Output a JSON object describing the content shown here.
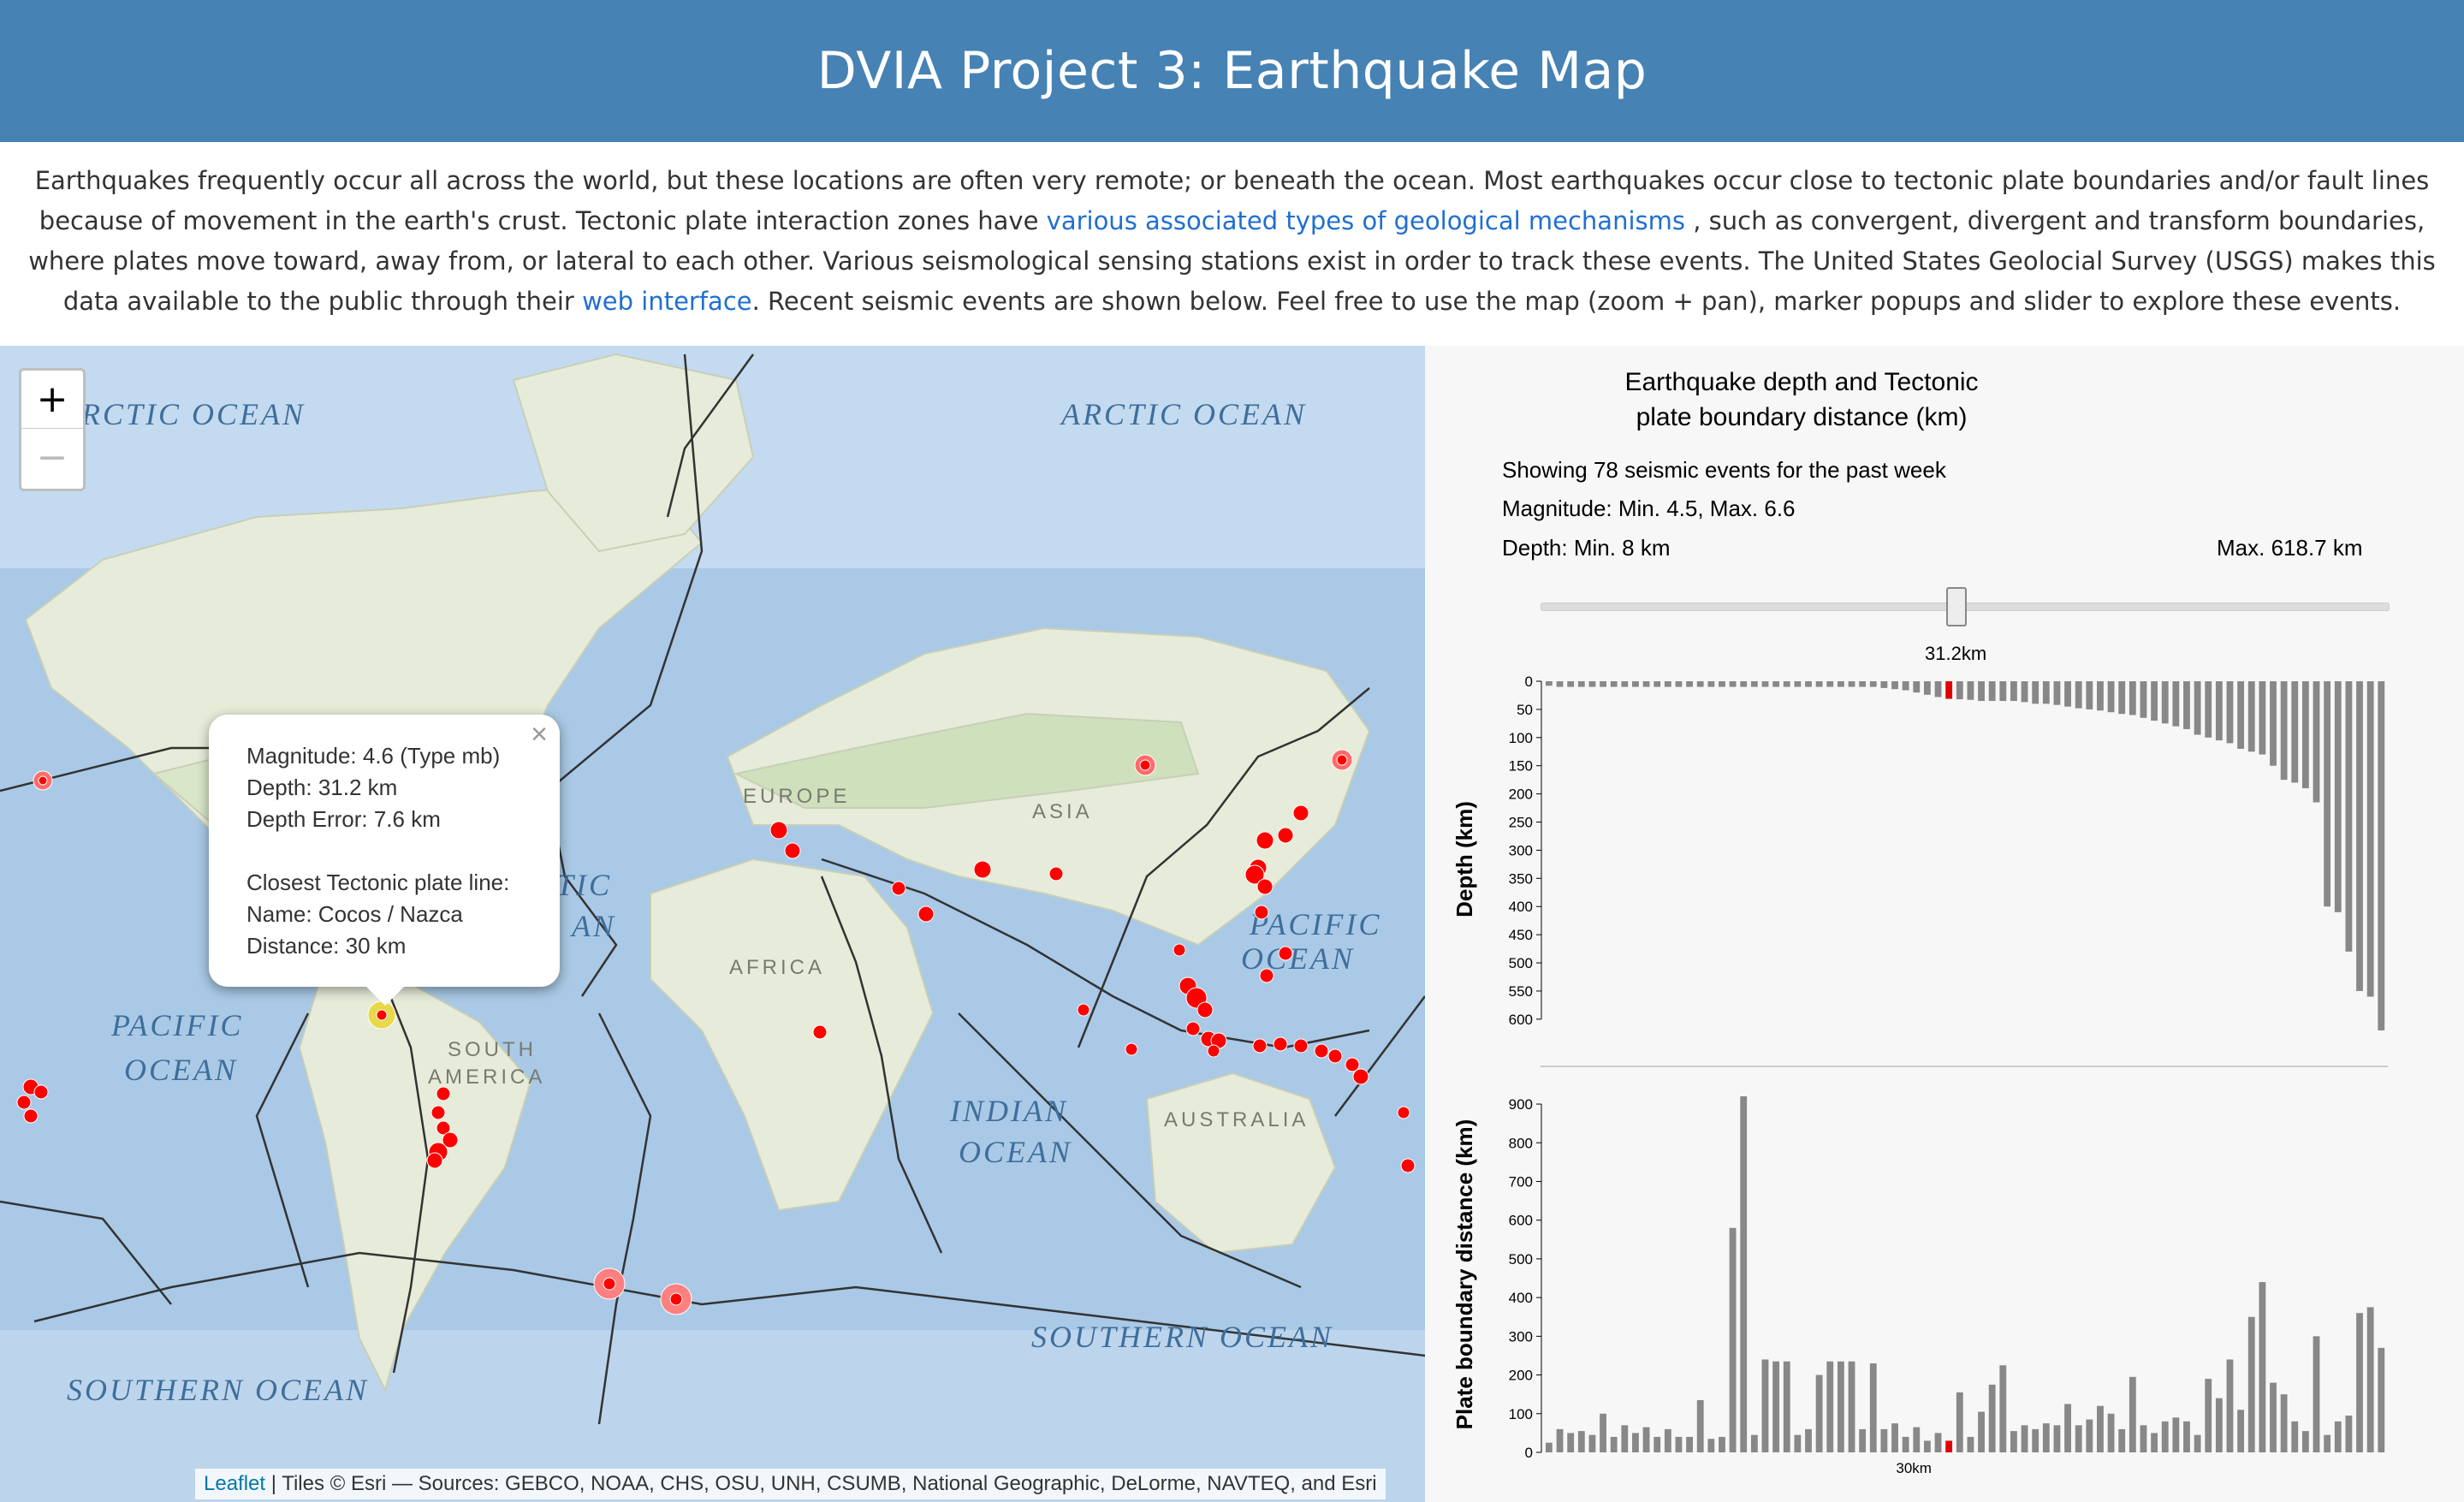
{
  "header": {
    "title": "DVIA Project 3: Earthquake Map"
  },
  "intro": {
    "part1": "Earthquakes frequently occur all across the world, but these locations are often very remote; or beneath the ocean. Most earthquakes occur close to tectonic plate boundaries and/or fault lines because of movement in the earth's crust. Tectonic plate interaction zones have ",
    "link1": "various associated types of geological mechanisms",
    "part2": " , such as convergent, divergent and transform boundaries, where plates move toward, away from, or lateral to each other. Various seismological sensing stations exist in order to track these events. The United States Geolocial Survey (USGS) makes this data available to the public through their ",
    "link2": "web interface",
    "part3": ". Recent seismic events are shown below. Feel free to use the map (zoom + pan), marker popups and slider to explore these events."
  },
  "map": {
    "zoom_in": "+",
    "zoom_out": "−",
    "labels": [
      "RCTIC OCEAN",
      "ARCTIC OCEAN",
      "EUROPE",
      "ASIA",
      "AFRICA",
      "SOUTH AMERICA",
      "PACIFIC OCEAN",
      "PACIFIC OCEAN",
      "INDIAN OCEAN",
      "AUSTRALIA",
      "SOUTHERN OCEAN",
      "SOUTHERN OCEAN",
      "ATLANTIC OCEAN"
    ],
    "popup": {
      "close": "×",
      "magnitude": "Magnitude: 4.6 (Type mb)",
      "depth": "Depth: 31.2 km",
      "depth_error": "Depth Error: 7.6 km",
      "closest_heading": "Closest Tectonic plate line:",
      "name": "Name: Cocos / Nazca",
      "distance": "Distance: 30 km"
    },
    "attribution_link": "Leaflet",
    "attribution_text": " | Tiles © Esri — Sources: GEBCO, NOAA, CHS, OSU, UNH, CSUMB, National Geographic, DeLorme, NAVTEQ, and Esri",
    "colors": {
      "marker": "#ff0000",
      "selected_marker": "#e8d84a",
      "plate_lines": "#333333",
      "ocean": "#a9c9e6",
      "land": "#e8eedc"
    }
  },
  "panel": {
    "title_line1": "Earthquake depth and Tectonic",
    "title_line2": "plate boundary distance (km)",
    "showing": "Showing 78 seismic events for the past week",
    "magnitude": "Magnitude: Min. 4.5,  Max. 6.6",
    "depth_min": "Depth: Min. 8 km",
    "depth_max": "Max. 618.7 km",
    "slider_value": 0.49,
    "slider_label": "31.2km"
  },
  "chart_data": [
    {
      "type": "bar",
      "ylabel": "Depth (km)",
      "yticks": [
        0,
        50,
        100,
        150,
        200,
        250,
        300,
        350,
        400,
        450,
        500,
        550,
        600
      ],
      "ylim": [
        0,
        620
      ],
      "highlight_index": 37,
      "highlight_color": "#e00000",
      "bar_color": "#888888",
      "values": [
        8,
        10,
        10,
        10,
        10,
        10,
        10,
        10,
        10,
        10,
        10,
        10,
        10,
        10,
        10,
        10,
        10,
        10,
        10,
        10,
        10,
        10,
        10,
        10,
        10,
        10,
        10,
        10,
        10,
        10,
        10,
        12,
        14,
        16,
        20,
        24,
        28,
        31.2,
        32,
        33,
        35,
        35,
        35,
        35,
        37,
        40,
        40,
        42,
        45,
        48,
        50,
        52,
        55,
        58,
        60,
        65,
        70,
        75,
        80,
        85,
        95,
        100,
        105,
        110,
        120,
        125,
        130,
        150,
        175,
        180,
        190,
        215,
        400,
        410,
        480,
        550,
        560,
        620
      ]
    },
    {
      "type": "bar",
      "ylabel": "Plate boundary distance (km)",
      "xlabel_highlight": "30km",
      "yticks": [
        0,
        100,
        200,
        300,
        400,
        500,
        600,
        700,
        800,
        900
      ],
      "ylim": [
        0,
        920
      ],
      "highlight_index": 37,
      "highlight_color": "#e00000",
      "bar_color": "#888888",
      "values": [
        25,
        60,
        50,
        55,
        45,
        100,
        40,
        70,
        50,
        65,
        40,
        60,
        40,
        40,
        135,
        35,
        40,
        580,
        920,
        45,
        240,
        235,
        235,
        45,
        60,
        200,
        235,
        235,
        235,
        60,
        230,
        60,
        75,
        40,
        65,
        30,
        50,
        30,
        155,
        40,
        105,
        175,
        225,
        55,
        70,
        60,
        75,
        70,
        125,
        70,
        85,
        120,
        100,
        60,
        195,
        70,
        50,
        80,
        90,
        80,
        45,
        190,
        140,
        240,
        110,
        350,
        440,
        180,
        150,
        80,
        55,
        300,
        45,
        80,
        95,
        360,
        375,
        270
      ]
    }
  ]
}
